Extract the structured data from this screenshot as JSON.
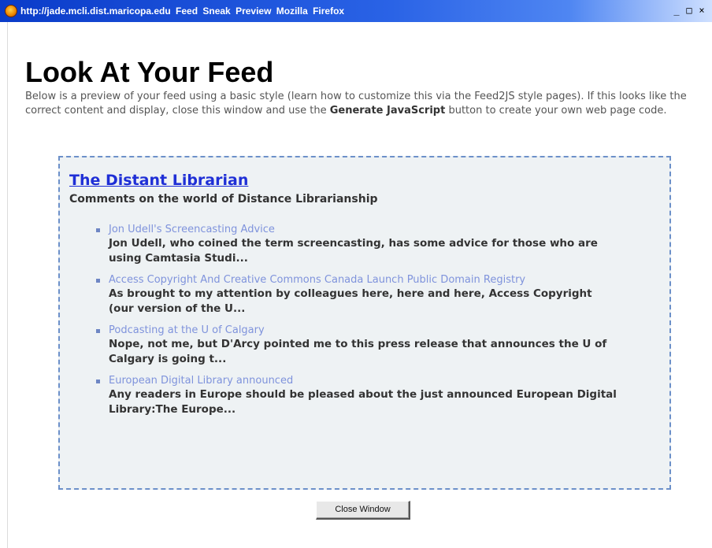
{
  "window": {
    "title": "http://jade.mcli.dist.maricopa.edu  Feed Sneak Preview  Mozilla Firefox",
    "controls": {
      "minimize": "_",
      "maximize": "□",
      "close": "×"
    }
  },
  "page": {
    "heading": "Look At Your Feed",
    "intro_before": "Below is a preview of your feed using a basic style (learn how to customize this via the Feed2JS style pages). If this looks like the correct content and display, close this window and use the ",
    "intro_bold": "Generate JavaScript",
    "intro_after": " button to create your own web page code."
  },
  "feed": {
    "title": "The Distant Librarian",
    "description": "Comments on the world of Distance Librarianship",
    "items": [
      {
        "title": "Jon Udell's Screencasting Advice",
        "description": "Jon Udell, who coined the term screencasting, has some advice for those who are using Camtasia Studi..."
      },
      {
        "title": "Access Copyright And Creative Commons Canada Launch Public Domain Registry",
        "description": "As brought to my attention by colleagues here, here and here, Access Copyright (our version of the U..."
      },
      {
        "title": "Podcasting at the U of Calgary",
        "description": "Nope, not me, but D'Arcy pointed me to this press release that announces the U of Calgary is going t..."
      },
      {
        "title": "European Digital Library announced",
        "description": "Any readers in Europe should be pleased about the just announced European Digital Library:The Europe..."
      }
    ]
  },
  "buttons": {
    "close_window": "Close Window"
  },
  "colors": {
    "titlebar": "#2a63e6",
    "feed_box_bg": "#eef2f4",
    "feed_box_border": "#6c90c9",
    "feed_title": "#1f2fd6",
    "item_link": "#7f93dc"
  }
}
